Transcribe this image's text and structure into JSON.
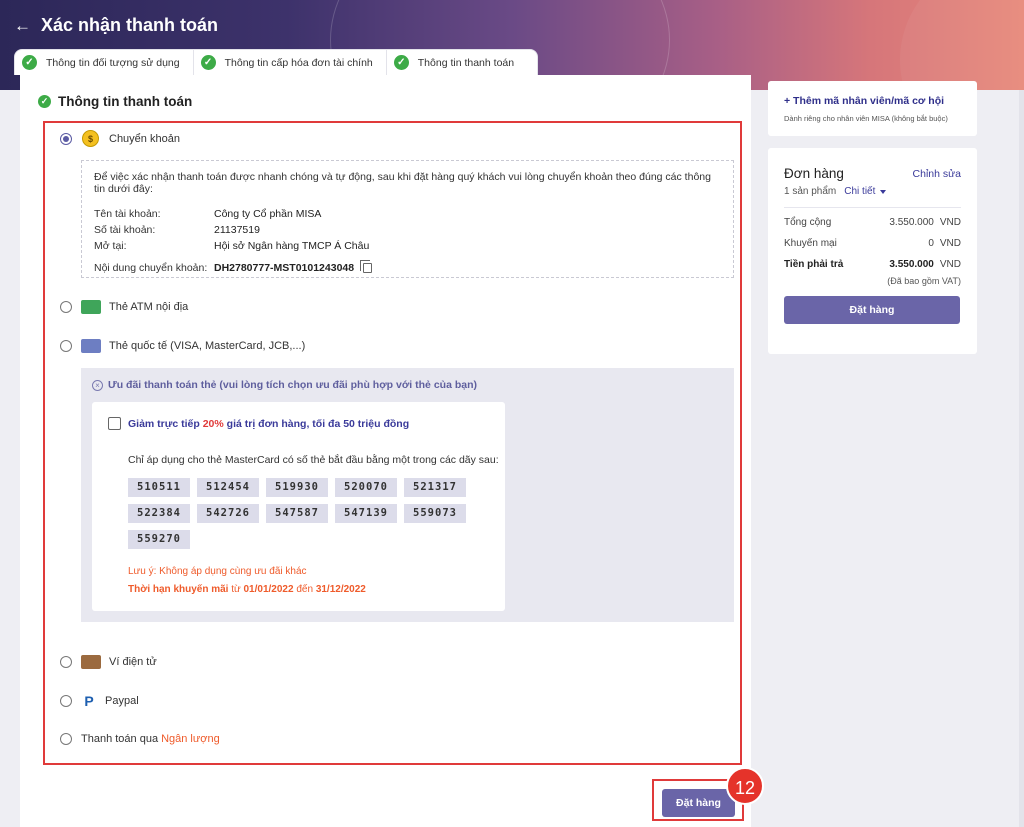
{
  "header": {
    "title": "Xác nhận thanh toán",
    "steps": [
      {
        "label": "Thông tin đối tượng sử dụng"
      },
      {
        "label": "Thông tin cấp hóa đơn tài chính"
      },
      {
        "label": "Thông tin thanh toán"
      }
    ]
  },
  "section": {
    "title": "Thông tin thanh toán"
  },
  "payment": {
    "bank_transfer": {
      "label": "Chuyển khoản",
      "selected": true,
      "intro": "Để việc xác nhận thanh toán được nhanh chóng và tự động, sau khi đặt hàng quý khách vui lòng chuyển khoản theo đúng các thông tin dưới đây:",
      "account_name_label": "Tên tài khoản:",
      "account_name": "Công ty Cổ phần MISA",
      "account_no_label": "Số tài khoản:",
      "account_no": "21137519",
      "bank_label": "Mở tại:",
      "bank": "Hội sở Ngân hàng TMCP Á Châu",
      "content_label": "Nội dung chuyển khoản:",
      "content": "DH2780777-MST0101243048"
    },
    "atm": {
      "label": "Thẻ ATM nội địa"
    },
    "intl": {
      "label": "Thẻ quốc tế (VISA, MasterCard, JCB,...)"
    },
    "promo": {
      "header": "Ưu đãi thanh toán thẻ (vui lòng tích chọn ưu đãi phù hợp với thẻ của bạn)",
      "title_pre": "Giảm trực tiếp ",
      "title_pct": "20%",
      "title_post": " giá trị đơn hàng, tối đa 50 triệu đồng",
      "desc": "Chỉ áp dụng cho thẻ MasterCard có số thẻ bắt đầu bằng một trong các dãy sau:",
      "codes": [
        "510511",
        "512454",
        "519930",
        "520070",
        "521317",
        "522384",
        "542726",
        "547587",
        "547139",
        "559073",
        "559270"
      ],
      "note": "Lưu ý: Không áp dụng cùng ưu đãi khác",
      "period_label": "Thời hạn khuyến mãi",
      "period_from_word": " từ ",
      "period_from": "01/01/2022",
      "period_to_word": " đến ",
      "period_to": "31/12/2022"
    },
    "ewallet": {
      "label": "Ví điện tử"
    },
    "paypal": {
      "label": "Paypal"
    },
    "nganluong": {
      "label_pre": "Thanh toán qua ",
      "label_link": "Ngân lượng"
    }
  },
  "main_order_button": "Đặt hàng",
  "step_badge": "12",
  "sidebar": {
    "employee_link": "+ Thêm mã nhân viên/mã cơ hội",
    "employee_sub": "Dành riêng cho nhân viên MISA (không bắt buộc)",
    "order": {
      "title": "Đơn hàng",
      "edit": "Chỉnh sửa",
      "count": "1 sản phẩm",
      "detail": "Chi tiết",
      "total_label": "Tổng cộng",
      "total_value": "3.550.000",
      "discount_label": "Khuyến mại",
      "discount_value": "0",
      "payable_label": "Tiền phải trả",
      "payable_value": "3.550.000",
      "currency": "VND",
      "vat_note": "(Đã bao gồm VAT)",
      "order_button": "Đặt hàng"
    }
  },
  "colors": {
    "accent": "#6a65a8",
    "success": "#3dab47",
    "highlight": "#e03a3a",
    "warning": "#ef5b2b"
  }
}
